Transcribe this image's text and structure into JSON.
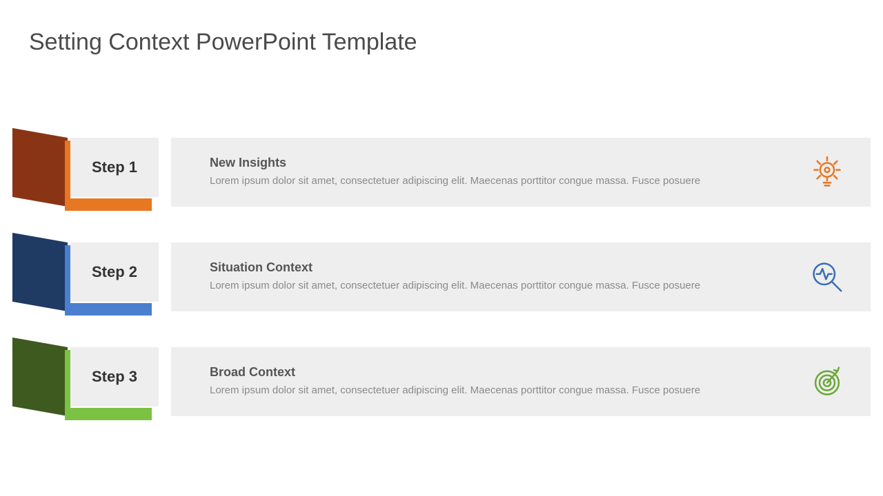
{
  "title": "Setting Context PowerPoint Template",
  "steps": [
    {
      "label": "Step 1",
      "heading": "New Insights",
      "body": "Lorem ipsum dolor sit amet, consectetuer adipiscing elit. Maecenas porttitor congue massa. Fusce posuere",
      "icon": "lightbulb-icon",
      "color_dark": "#8a3416",
      "color_accent": "#e87722"
    },
    {
      "label": "Step 2",
      "heading": "Situation Context",
      "body": "Lorem ipsum dolor sit amet, consectetuer adipiscing elit. Maecenas porttitor congue massa. Fusce posuere",
      "icon": "pulse-magnifier-icon",
      "color_dark": "#1f3a63",
      "color_accent": "#4a7fcf"
    },
    {
      "label": "Step 3",
      "heading": "Broad Context",
      "body": "Lorem ipsum dolor sit amet, consectetuer adipiscing elit. Maecenas porttitor congue massa. Fusce posuere",
      "icon": "target-icon",
      "color_dark": "#3e5a1f",
      "color_accent": "#7cc242"
    }
  ]
}
